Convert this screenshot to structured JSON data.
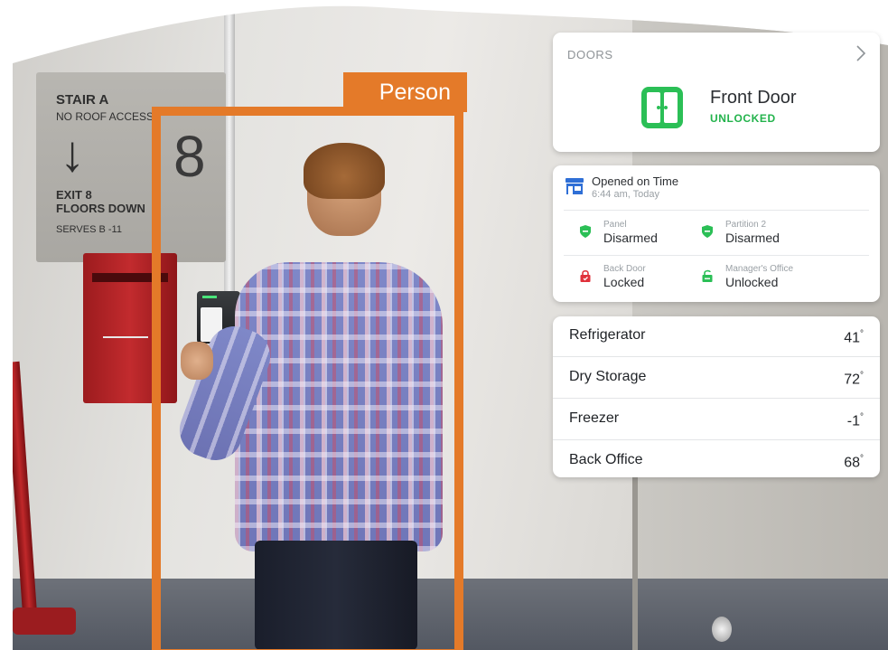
{
  "detection": {
    "label": "Person",
    "color": "#e47a29"
  },
  "scene": {
    "sign": {
      "title": "STAIR A",
      "subtitle": "NO ROOF ACCESS",
      "number": "8",
      "exit_line1": "EXIT 8",
      "exit_line2": "FLOORS DOWN",
      "serves": "SERVES B -11"
    }
  },
  "doors": {
    "section_label": "DOORS",
    "door_name": "Front Door",
    "door_status": "UNLOCKED",
    "status_color": "#23b34c",
    "icon": "door-icon"
  },
  "activity": {
    "event_title": "Opened on Time",
    "event_time": "6:44 am, Today",
    "event_icon": "storefront-icon"
  },
  "security": [
    {
      "label": "Panel",
      "value": "Disarmed",
      "icon": "shield-icon",
      "color": "#2bbf56"
    },
    {
      "label": "Partition 2",
      "value": "Disarmed",
      "icon": "shield-icon",
      "color": "#2bbf56"
    },
    {
      "label": "Back Door",
      "value": "Locked",
      "icon": "lock-icon",
      "color": "#e0313b"
    },
    {
      "label": "Manager's Office",
      "value": "Unlocked",
      "icon": "unlock-icon",
      "color": "#2bbf56"
    }
  ],
  "temperatures": [
    {
      "name": "Refrigerator",
      "value": "41",
      "unit": "°"
    },
    {
      "name": "Dry Storage",
      "value": "72",
      "unit": "°"
    },
    {
      "name": "Freezer",
      "value": "-1",
      "unit": "°"
    },
    {
      "name": "Back Office",
      "value": "68",
      "unit": "°"
    }
  ]
}
